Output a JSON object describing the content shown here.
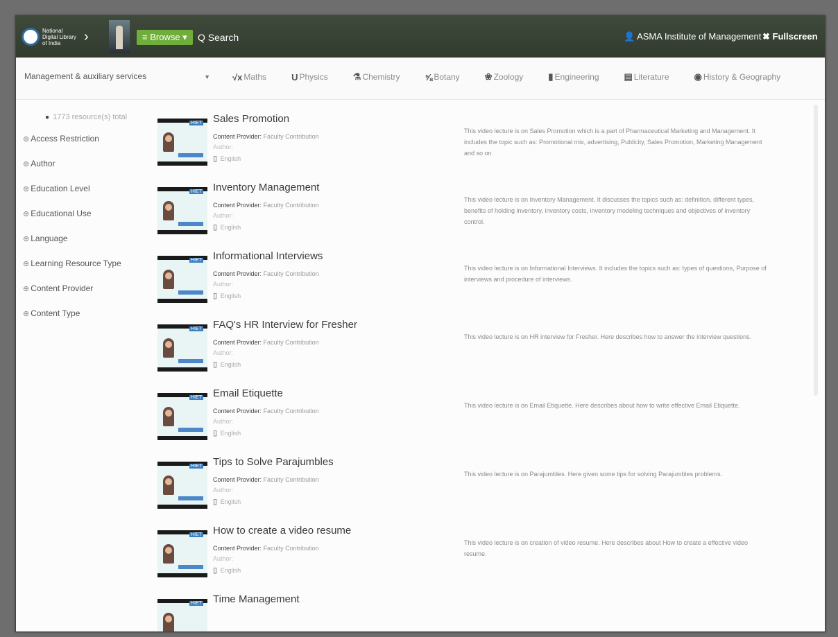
{
  "header": {
    "logo_lines": [
      "National",
      "Digital Library",
      "of India"
    ],
    "browse_label": "≡ Browse ▾",
    "search_label": "Q Search",
    "user_label": "ASMA Institute of Management ▾",
    "fullscreen_label": "Fullscreen"
  },
  "subject_bar": {
    "selected": "Management & auxiliary services",
    "tabs": [
      {
        "icon": "√x",
        "label": "Maths"
      },
      {
        "icon": "U",
        "label": "Physics"
      },
      {
        "icon": "⚗",
        "label": "Chemistry"
      },
      {
        "icon": "⅝",
        "label": "Botany"
      },
      {
        "icon": "❀",
        "label": "Zoology"
      },
      {
        "icon": "▮",
        "label": "Engineering"
      },
      {
        "icon": "▤",
        "label": "Literature"
      },
      {
        "icon": "◉",
        "label": "History & Geography"
      }
    ]
  },
  "facets": {
    "count_text": "1773 resource(s) total",
    "items": [
      "Access Restriction",
      "Author",
      "Education Level",
      "Educational Use",
      "Language",
      "Learning Resource Type",
      "Content Provider",
      "Content Type"
    ]
  },
  "results": [
    {
      "title": "Sales Promotion",
      "provider_label": "Content Provider:",
      "provider": "Faculty Contribution",
      "author": "Author: ",
      "language": "English",
      "description": "This video lecture is on Sales Promotion which is a part of Pharmaceutical Marketing and Management. It includes the topic such as: Promotional mix, advertising, Publicity, Sales Promotion, Marketing Management and so on."
    },
    {
      "title": "Inventory Management",
      "provider_label": "Content Provider:",
      "provider": "Faculty Contribution",
      "author": "Author: ",
      "language": "English",
      "description": "This video lecture is on Inventory Management. It discusses the topics such as: definition, different types, benefits of holding inventory, inventory costs, inventory modeling techniques and objectives of inventory control."
    },
    {
      "title": "Informational Interviews",
      "provider_label": "Content Provider:",
      "provider": "Faculty Contribution",
      "author": "Author: ",
      "language": "English",
      "description": "This video lecture is on Informational Interviews. It includes the topics such as: types of questions, Purpose of interviews and procedure of interviews."
    },
    {
      "title": "FAQ's HR Interview for Fresher",
      "provider_label": "Content Provider:",
      "provider": "Faculty Contribution",
      "author": "Author: ",
      "language": "English",
      "description": "This video lecture is on HR interview for Fresher. Here describes how to answer the interview questions."
    },
    {
      "title": "Email Etiquette",
      "provider_label": "Content Provider:",
      "provider": "Faculty Contribution",
      "author": "Author: ",
      "language": "English",
      "description": "This video lecture is on Email Etiquette. Here describes about how to write effective Email Etiquette."
    },
    {
      "title": "Tips to Solve Parajumbles",
      "provider_label": "Content Provider:",
      "provider": "Faculty Contribution",
      "author": "Author: ",
      "language": "English",
      "description": "This video lecture is on Parajumbles. Here given some tips for solving Parajumbles problems."
    },
    {
      "title": "How to create a video resume",
      "provider_label": "Content Provider:",
      "provider": "Faculty Contribution",
      "author": "Author: ",
      "language": "English",
      "description": "This video lecture is on creation of video resume. Here describes about How to create a effective video resume."
    },
    {
      "title": "Time Management",
      "provider_label": "",
      "provider": "",
      "author": "",
      "language": "",
      "description": ""
    }
  ]
}
